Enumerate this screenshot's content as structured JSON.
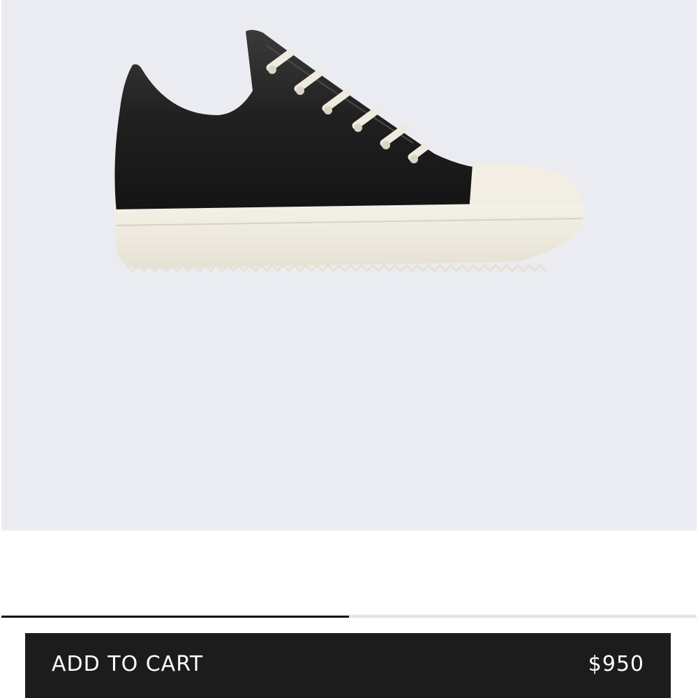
{
  "product": {
    "image_alt": "Black leather low-top sneaker with white rubber sole",
    "image_count": 2,
    "current_image": 1
  },
  "cart_bar": {
    "label": "ADD TO CART",
    "price": "$950"
  },
  "colors": {
    "image_background": "#ebecf1",
    "button_background": "#1c1c1c",
    "button_text": "#ffffff",
    "progress_indicator": "#111111"
  }
}
